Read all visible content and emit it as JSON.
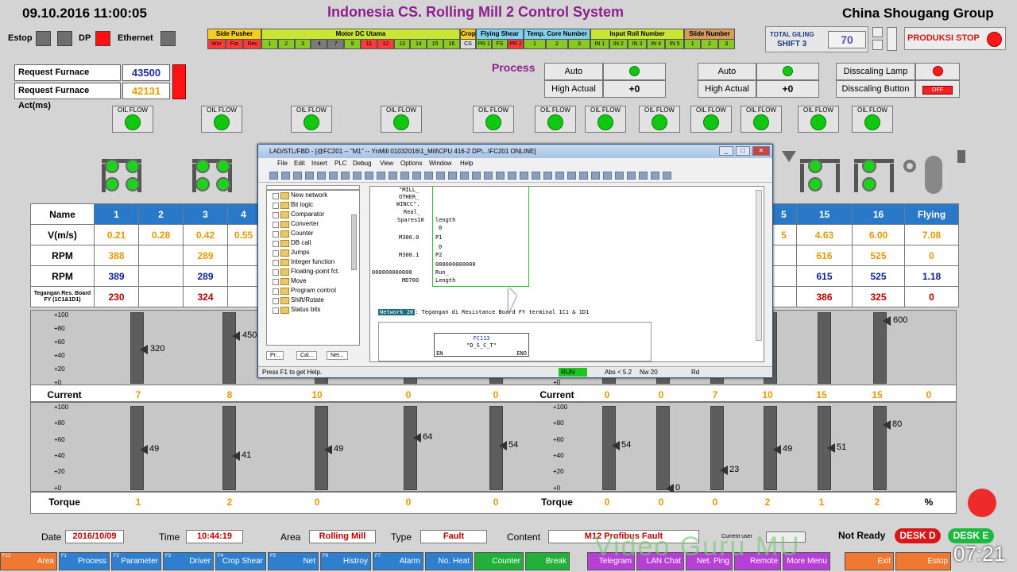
{
  "header": {
    "datetime": "09.10.2016  11:00:05",
    "title": "Indonesia CS. Rolling Mill 2 Control System",
    "company": "China Shougang Group",
    "estop_label": "Estop",
    "dp_label": "DP",
    "ethernet_label": "Ethernet"
  },
  "status_groups": [
    {
      "title": "Side Pusher",
      "color": "#f5ce1f",
      "cells": [
        "Wor",
        "For",
        "Rev"
      ],
      "cell_color": "#ff3a3a"
    },
    {
      "title": "Motor DC Utama",
      "color": "#c9e635",
      "cells": [
        "1",
        "2",
        "3",
        "4",
        "7",
        "9",
        "11",
        "12",
        "13",
        "14",
        "15",
        "16"
      ]
    },
    {
      "title": "Crope Shear",
      "color": "#f5ce1f",
      "cells": [
        "CS"
      ]
    },
    {
      "title": "Flying Shear Pinch Roll",
      "color": "#7fd2ef",
      "cells": [
        "PR 1",
        "FS",
        "PR 2"
      ]
    },
    {
      "title": "Temp. Core Number",
      "color": "#7fd2ef",
      "cells": [
        "1",
        "2",
        "3"
      ]
    },
    {
      "title": "Input Roll Number",
      "color": "#c9e635",
      "cells": [
        "IN 1",
        "IN 2",
        "IN 3",
        "IN 4",
        "IN 5"
      ]
    },
    {
      "title": "Slide Number",
      "color": "#d8995a",
      "cells": [
        "1",
        "2",
        "3"
      ]
    }
  ],
  "total_giling": {
    "label1": "TOTAL GILING",
    "label2": "SHIFT 3",
    "value": "70"
  },
  "produksi_stop": "PRODUKSI STOP",
  "request": {
    "set_label": "Request Furnace Set(ms)",
    "set_value": "43500",
    "act_label": "Request Furnace Act(ms)",
    "act_value": "42131"
  },
  "process": {
    "title": "Process",
    "left": {
      "auto": "Auto",
      "high": "High Actual",
      "high_value": "+0"
    },
    "right": {
      "auto": "Auto",
      "high": "High Actual",
      "high_value": "+0"
    },
    "descaling_lamp": "Disscaling Lamp",
    "descaling_button": "Disscaling Button",
    "descaling_state": "OFF"
  },
  "oil_flow_label": "OIL FLOW",
  "table": {
    "name_header": "Name",
    "left_cols": [
      "1",
      "2",
      "3",
      "4"
    ],
    "right_cols": [
      "5",
      "15",
      "16",
      "Flying"
    ],
    "rows": [
      {
        "name": "V(m/s)",
        "left": [
          "0.21",
          "0.28",
          "0.42",
          "0.55"
        ],
        "right": [
          "5",
          "4.63",
          "6.00",
          "7.08"
        ],
        "cls": "ora"
      },
      {
        "name": "RPM",
        "left": [
          "388",
          "",
          "289",
          ""
        ],
        "right": [
          "",
          "616",
          "525",
          "0"
        ],
        "cls": "ora"
      },
      {
        "name": "RPM",
        "left": [
          "389",
          "",
          "289",
          ""
        ],
        "right": [
          "",
          "615",
          "525",
          "1.18"
        ],
        "cls": "blu"
      },
      {
        "name": "Tegangan Res. Board FY (1C1&1D1)",
        "left": [
          "230",
          "",
          "324",
          ""
        ],
        "right": [
          "",
          "386",
          "325",
          "0"
        ],
        "cls": "red-t"
      }
    ]
  },
  "gauges": {
    "scale": [
      "+100",
      "+80",
      "+60",
      "+40",
      "+20",
      "+0"
    ],
    "upper_values": [
      "320",
      "450",
      "600"
    ],
    "current_label": "Current",
    "current_left": [
      "7",
      "8",
      "10",
      "0",
      "0"
    ],
    "current_right": [
      "0",
      "0",
      "7",
      "10",
      "15",
      "15",
      "0"
    ],
    "lower_left_values": [
      "49",
      "41",
      "49",
      "64",
      "54"
    ],
    "lower_right_values": [
      "54",
      "0",
      "23",
      "49",
      "51",
      "80"
    ],
    "torque_label": "Torque",
    "torque_left": [
      "1",
      "2",
      "0",
      "0",
      "0"
    ],
    "torque_right": [
      "0",
      "0",
      "0",
      "2",
      "1",
      "2",
      "%"
    ]
  },
  "window": {
    "title": "LAD/STL/FBD - [@FC201 -- \"M1\" -- YnMill 01032016\\1_Mill\\CPU 416-2 DP\\...\\FC201  ONLINE]",
    "menu": [
      "File",
      "Edit",
      "Insert",
      "PLC",
      "Debug",
      "View",
      "Options",
      "Window",
      "Help"
    ],
    "tree": [
      "New network",
      "Bit logic",
      "Comparator",
      "Converter",
      "Counter",
      "DB call",
      "Jumps",
      "Integer function",
      "Floating-point fct.",
      "Move",
      "Program control",
      "Shift/Rotate",
      "Status bits"
    ],
    "tabs": [
      "Pr...",
      "Cal...",
      "Net..."
    ],
    "code_lines": [
      "\"MILL_",
      "OTHER_",
      "WINCC\".",
      "Real_",
      "Spares10",
      "length",
      "0",
      "M300.0",
      "P1",
      "0",
      "M300.1",
      "P2",
      "000000000000",
      "000000000000",
      "Run_",
      "MD700",
      "Length"
    ],
    "network_title": "Network 20",
    "network_comment": ": Tegangan di Resistance Board FY terminal 1C1 & 1D1",
    "block_name": "FC113",
    "block_sub": "\"D_S_C_T\"",
    "en": "EN",
    "eno": "ENO",
    "status_help": "Press F1 to get Help.",
    "status_run": "RUN",
    "status_abs": "Abs < 5.2",
    "status_nw": "Nw 20",
    "status_rd": "Rd"
  },
  "footer": {
    "date_label": "Date",
    "date_value": "2016/10/09",
    "time_label": "Time",
    "time_value": "10:44:19",
    "area_label": "Area",
    "area_value": "Rolling Mill",
    "type_label": "Type",
    "type_value": "Fault",
    "content_label": "Content",
    "content_value": "M12 Profibus Fault",
    "current_user": "Current user",
    "not_ready": "Not Ready",
    "desk_d": "DESK D",
    "desk_e": "DESK E",
    "watermark": "Video Guru MU",
    "clock": "07:21"
  },
  "fkeys": [
    {
      "fn": "F12",
      "label": "Area",
      "color": "#f07830"
    },
    {
      "fn": "F1",
      "label": "Process",
      "color": "#2f7fd0"
    },
    {
      "fn": "F2",
      "label": "Parameter",
      "color": "#2f7fd0"
    },
    {
      "fn": "F3",
      "label": "Driver",
      "color": "#2f7fd0"
    },
    {
      "fn": "F4",
      "label": "Crop Shear",
      "color": "#2f7fd0"
    },
    {
      "fn": "F5",
      "label": "Net",
      "color": "#2f7fd0"
    },
    {
      "fn": "F6",
      "label": "Histroy",
      "color": "#2f7fd0"
    },
    {
      "fn": "F7",
      "label": "Alarm",
      "color": "#2f7fd0"
    },
    {
      "fn": "",
      "label": "No. Heat",
      "color": "#2f7fd0"
    },
    {
      "fn": "",
      "label": "Counter Giling",
      "color": "#22b03a"
    },
    {
      "fn": "",
      "label": "Break Down",
      "color": "#22b03a"
    },
    {
      "fn": "",
      "label": "Telegram",
      "color": "#b63fd6"
    },
    {
      "fn": "",
      "label": "LAN Chat",
      "color": "#b63fd6"
    },
    {
      "fn": "",
      "label": "Net. Ping",
      "color": "#b63fd6"
    },
    {
      "fn": "",
      "label": "Remote",
      "color": "#b63fd6"
    },
    {
      "fn": "",
      "label": "More Menu",
      "color": "#b63fd6"
    },
    {
      "fn": "",
      "label": "Exit",
      "color": "#f07830"
    },
    {
      "fn": "",
      "label": "Estop",
      "color": "#f07830"
    }
  ]
}
